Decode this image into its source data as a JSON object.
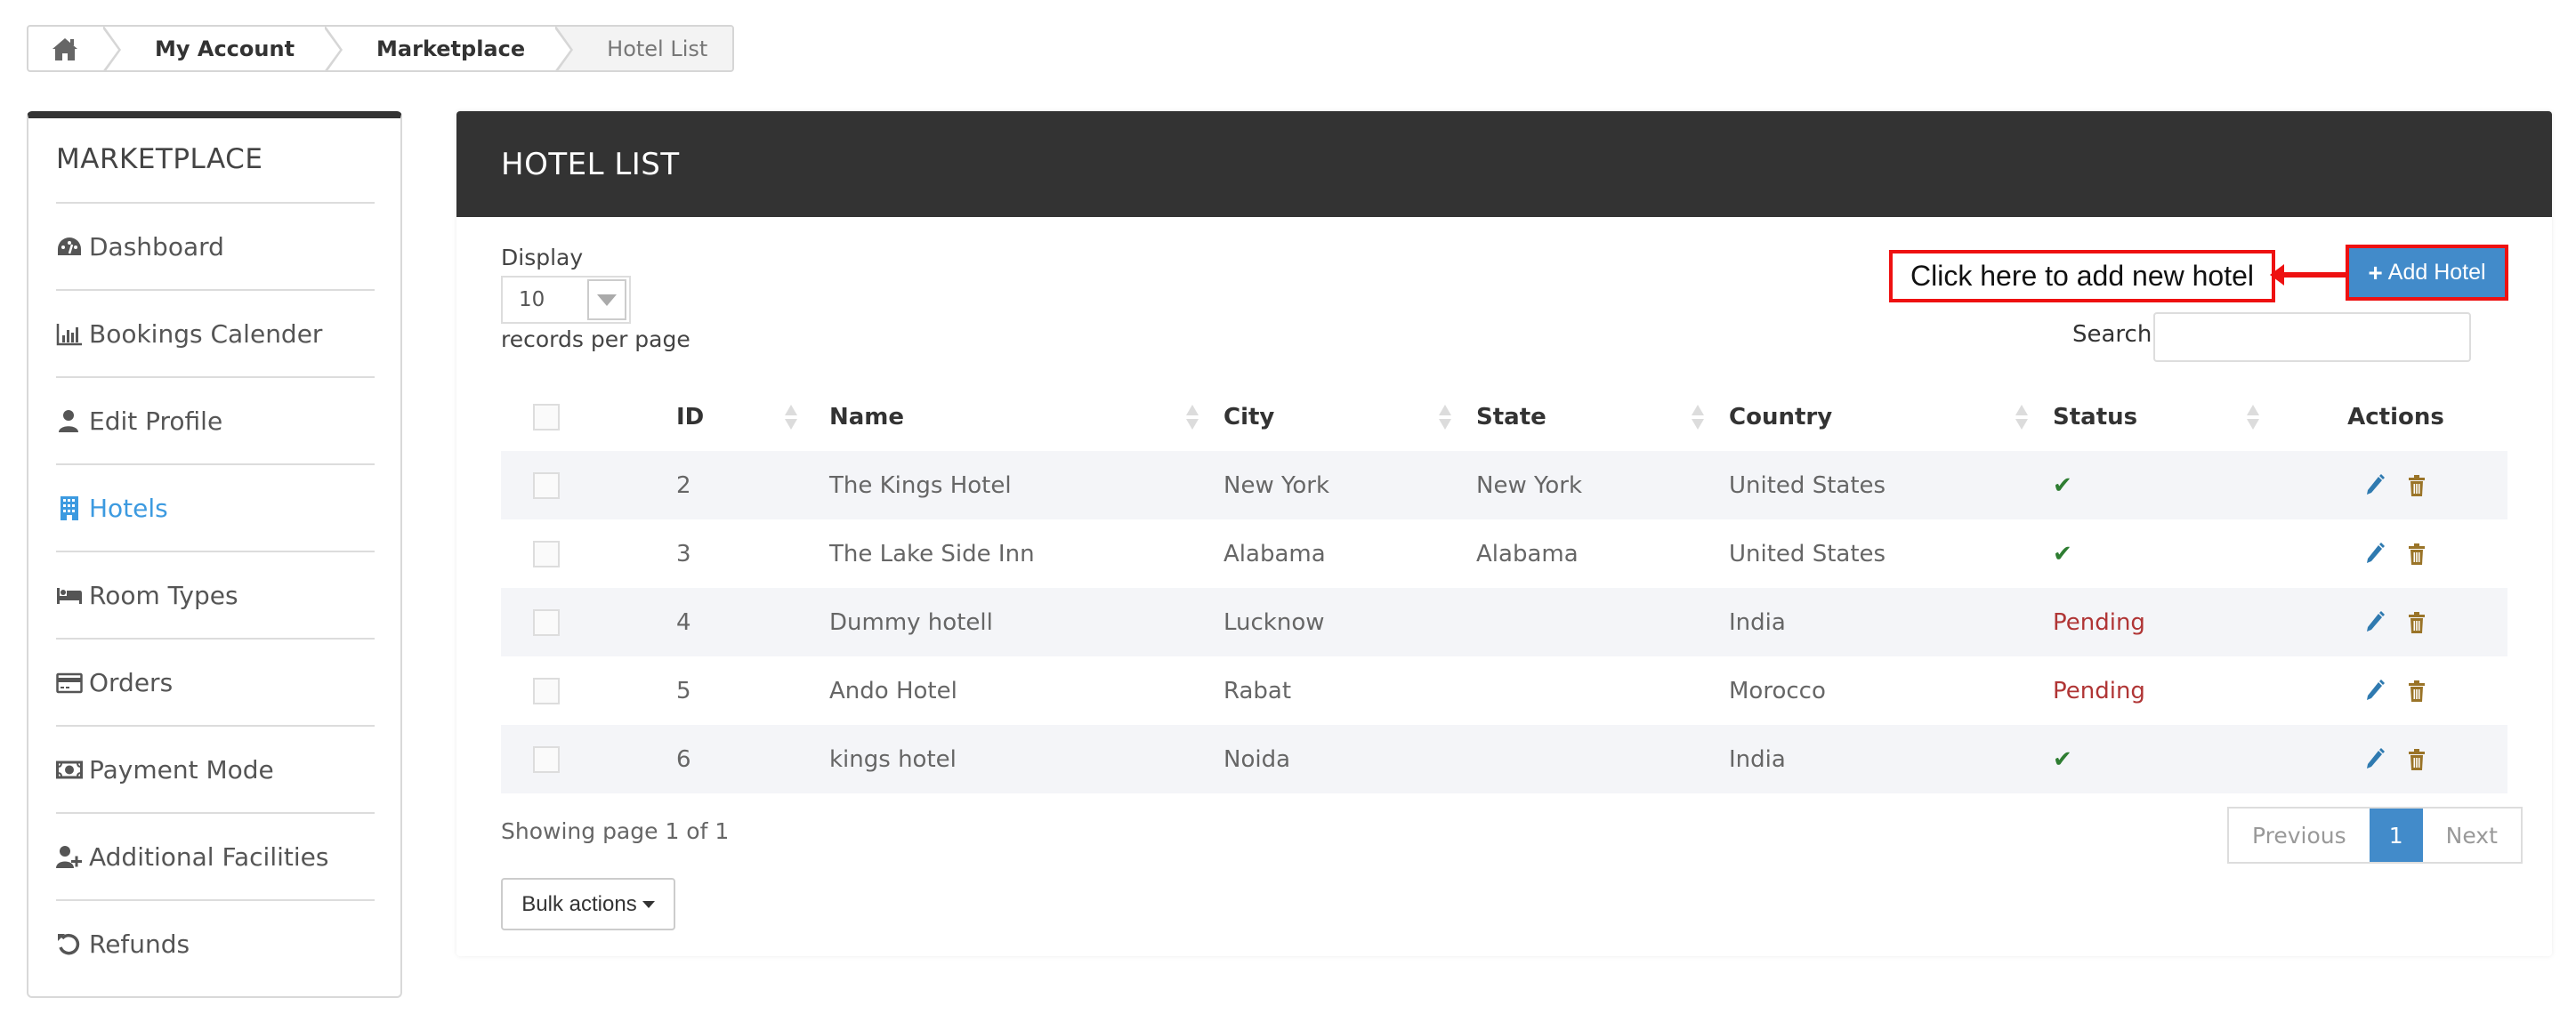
{
  "breadcrumb": {
    "home_icon": "home-icon",
    "items": [
      "My Account",
      "Marketplace",
      "Hotel List"
    ]
  },
  "sidebar": {
    "title": "MARKETPLACE",
    "items": [
      {
        "label": "Dashboard",
        "icon": "dashboard-icon",
        "active": false
      },
      {
        "label": "Bookings Calender",
        "icon": "bar-chart-icon",
        "active": false
      },
      {
        "label": "Edit Profile",
        "icon": "user-icon",
        "active": false
      },
      {
        "label": "Hotels",
        "icon": "building-icon",
        "active": true
      },
      {
        "label": "Room Types",
        "icon": "bed-icon",
        "active": false
      },
      {
        "label": "Orders",
        "icon": "credit-card-icon",
        "active": false
      },
      {
        "label": "Payment Mode",
        "icon": "money-icon",
        "active": false
      },
      {
        "label": "Additional Facilities",
        "icon": "user-plus-icon",
        "active": false
      },
      {
        "label": "Refunds",
        "icon": "undo-icon",
        "active": false
      }
    ]
  },
  "panel": {
    "title": "HOTEL LIST",
    "display_label": "Display",
    "display_value": "10",
    "records_label": "records per page",
    "callout_text": "Click here to add new hotel",
    "add_button_label": "Add Hotel",
    "search_label": "Search",
    "search_value": ""
  },
  "table": {
    "columns": [
      "ID",
      "Name",
      "City",
      "State",
      "Country",
      "Status",
      "Actions"
    ],
    "rows": [
      {
        "id": "2",
        "name": "The Kings Hotel",
        "city": "New York",
        "state": "New York",
        "country": "United States",
        "status": "active",
        "status_text": "✔"
      },
      {
        "id": "3",
        "name": "The Lake Side Inn",
        "city": "Alabama",
        "state": "Alabama",
        "country": "United States",
        "status": "active",
        "status_text": "✔"
      },
      {
        "id": "4",
        "name": "Dummy hotell",
        "city": "Lucknow",
        "state": "",
        "country": "India",
        "status": "pending",
        "status_text": "Pending"
      },
      {
        "id": "5",
        "name": "Ando Hotel",
        "city": "Rabat",
        "state": "",
        "country": "Morocco",
        "status": "pending",
        "status_text": "Pending"
      },
      {
        "id": "6",
        "name": "kings hotel",
        "city": "Noida",
        "state": "",
        "country": "India",
        "status": "active",
        "status_text": "✔"
      }
    ]
  },
  "footer": {
    "showing": "Showing page 1 of 1",
    "pagination": {
      "previous": "Previous",
      "current": "1",
      "next": "Next"
    },
    "bulk_actions": "Bulk actions"
  },
  "colors": {
    "accent": "#428bca",
    "active_link": "#3c9ae0",
    "header_bg": "#333333",
    "status_ok": "#2e7d32",
    "status_pending": "#b03535",
    "callout": "#ee1111",
    "edit_icon": "#2f7ab0",
    "delete_icon": "#9a7428"
  }
}
